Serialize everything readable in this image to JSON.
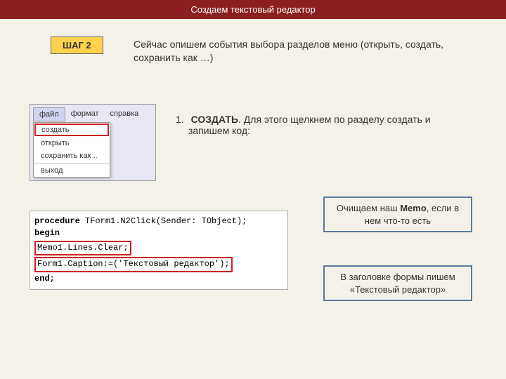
{
  "header": {
    "title": "Создаем текстовый редактор"
  },
  "step": {
    "badge": "ШАГ 2",
    "description": "Сейчас опишем события выбора разделов меню (открыть, создать, сохранить как …)"
  },
  "menu": {
    "bar": [
      "файл",
      "формат",
      "справка"
    ],
    "items": [
      "создать",
      "открыть",
      "сохранить как ..",
      "выход"
    ]
  },
  "instruction": {
    "num": "1.",
    "bold": "СОЗДАТЬ",
    "tail": ". Для этого щелкнем по разделу создать и",
    "line2": "запишем код:"
  },
  "code": {
    "l1a": "procedure",
    "l1b": " TForm1.N2Click(Sender: TObject);",
    "l2": "begin",
    "l3": " Memo1.Lines.Clear;",
    "l4": " Form1.Caption:=('Текстовый редактор');",
    "l5": "end;"
  },
  "callouts": {
    "c1_before": "Очищаем наш ",
    "c1_bold": "Memo",
    "c1_after": ", если в нем что-то есть",
    "c2": "В заголовке формы пишем «Текстовый редактор»"
  }
}
